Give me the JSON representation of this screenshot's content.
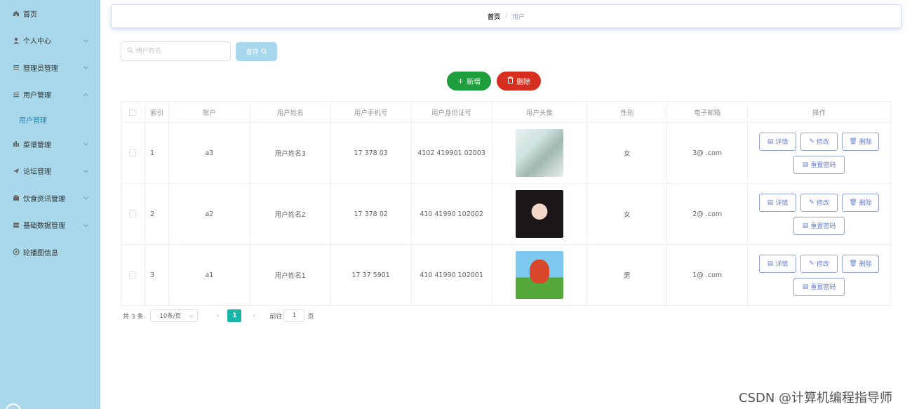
{
  "sidebar": {
    "items": [
      {
        "label": "首页",
        "icon": "home-icon",
        "has_children": false
      },
      {
        "label": "个人中心",
        "icon": "user-icon",
        "has_children": true
      },
      {
        "label": "管理员管理",
        "icon": "list-icon",
        "has_children": true
      },
      {
        "label": "用户管理",
        "icon": "list-icon",
        "has_children": true,
        "expanded": true
      },
      {
        "label": "菜谱管理",
        "icon": "bar-chart-icon",
        "has_children": true
      },
      {
        "label": "论坛管理",
        "icon": "send-icon",
        "has_children": true
      },
      {
        "label": "饮食资讯管理",
        "icon": "briefcase-icon",
        "has_children": true
      },
      {
        "label": "基础数据管理",
        "icon": "stack-icon",
        "has_children": true
      },
      {
        "label": "轮播图信息",
        "icon": "settings-icon",
        "has_children": false
      }
    ],
    "submenu_active": "用户管理"
  },
  "breadcrumb": {
    "home": "首页",
    "separator": "/",
    "current": "用户"
  },
  "search": {
    "placeholder": "用户姓名",
    "value": "",
    "query_label": "查询"
  },
  "actions": {
    "add_label": "新增",
    "delete_label": "删除"
  },
  "table": {
    "headers": [
      "索引",
      "账户",
      "用户姓名",
      "用户手机号",
      "用户身份证号",
      "用户头像",
      "性别",
      "电子邮箱",
      "操作"
    ],
    "rows": [
      {
        "index": "1",
        "account": "a3",
        "name": "用户姓名3",
        "phone": "17 378 03",
        "id_number": "4102 419901 02003",
        "gender": "女",
        "email": "3@ .com",
        "avatar": "avatar-photo-1"
      },
      {
        "index": "2",
        "account": "a2",
        "name": "用户姓名2",
        "phone": "17 378 02",
        "id_number": "410 41990 102002",
        "gender": "女",
        "email": "2@ .com",
        "avatar": "avatar-photo-2"
      },
      {
        "index": "3",
        "account": "a1",
        "name": "用户姓名1",
        "phone": "17 37 5901",
        "id_number": "410 41990 102001",
        "gender": "男",
        "email": "1@ .com",
        "avatar": "avatar-cartoon-3"
      }
    ],
    "row_actions": {
      "detail": "详情",
      "edit": "修改",
      "delete": "删除",
      "reset_password": "重置密码"
    }
  },
  "pagination": {
    "total_text": "共 3 条",
    "page_size": "10条/页",
    "current_page": "1",
    "goto_label": "前往",
    "goto_value": "1",
    "page_suffix": "页"
  },
  "watermark": "CSDN @计算机编程指导师",
  "colors": {
    "sidebar_bg": "#a8d8ea",
    "add": "#1e9e3d",
    "delete": "#d62f1f",
    "page_active": "#19b5a6",
    "query": "#a7d7ec"
  }
}
